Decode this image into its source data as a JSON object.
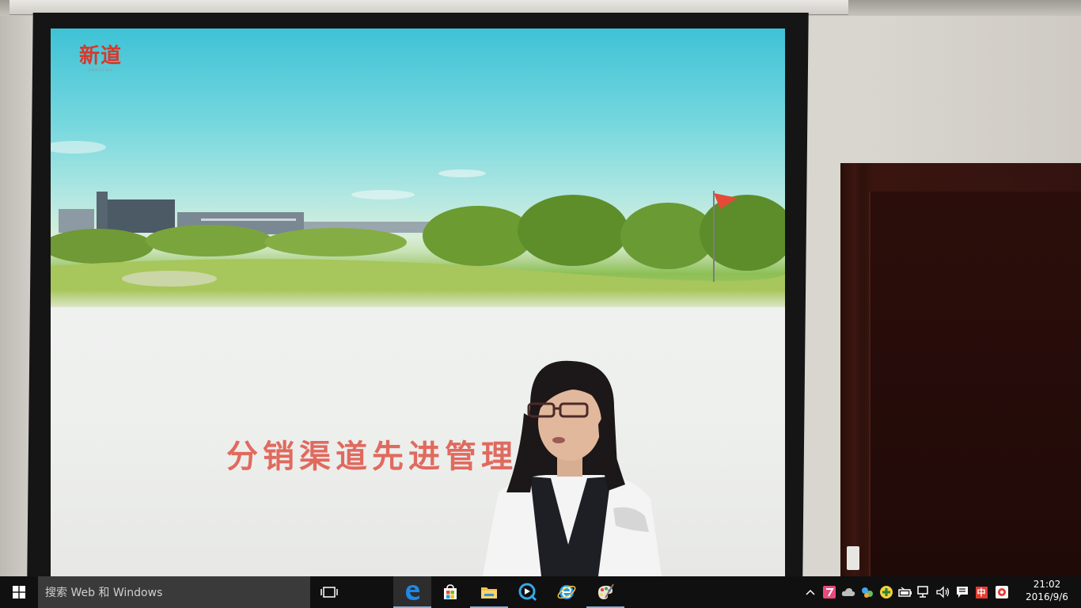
{
  "slide": {
    "logo_text": "新道",
    "logo_subtext": "seentao",
    "title": "分销渠道先进管理"
  },
  "taskbar": {
    "start_icon": "windows-start-icon",
    "search_placeholder": "搜索 Web 和 Windows",
    "task_view_icon": "task-view-icon",
    "pinned_apps": [
      {
        "name": "edge-browser",
        "icon": "edge-icon",
        "active": true
      },
      {
        "name": "store",
        "icon": "store-icon",
        "active": false
      },
      {
        "name": "file-explorer",
        "icon": "folder-icon",
        "active": false
      },
      {
        "name": "media-player",
        "icon": "media-player-icon",
        "active": false
      },
      {
        "name": "internet-explorer",
        "icon": "ie-icon",
        "active": false
      },
      {
        "name": "paint",
        "icon": "paint-icon",
        "active": false
      }
    ],
    "tray": {
      "overflow_icon": "chevron-up-icon",
      "ime_label": "中",
      "icons": [
        "app-tray-icon",
        "cloud-icon",
        "network-status-icon",
        "add-icon",
        "battery-icon",
        "network-icon",
        "volume-icon",
        "action-center-icon",
        "security-icon"
      ]
    },
    "clock": {
      "time": "21:02",
      "date": "2016/9/6"
    }
  },
  "colors": {
    "taskbar_bg": "#101010",
    "search_bg": "#3a3a3a",
    "slide_title_color": "#e06a5e",
    "logo_color": "#d8392a",
    "ime_badge": "#e33d31"
  }
}
